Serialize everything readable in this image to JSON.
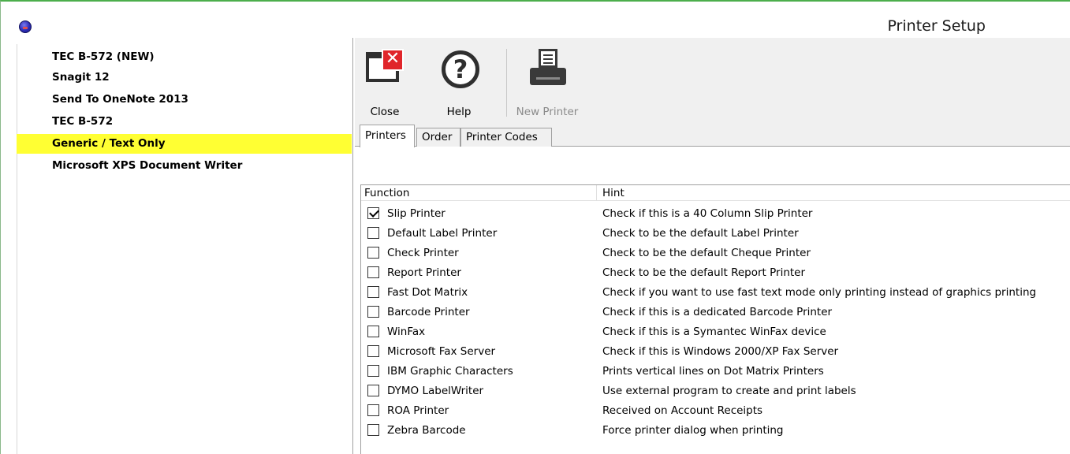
{
  "window": {
    "title": "Printer Setup"
  },
  "printers": [
    {
      "name": "TEC B-572 (NEW)",
      "selected": false
    },
    {
      "name": "Snagit 12",
      "selected": false
    },
    {
      "name": "Send To OneNote 2013",
      "selected": false
    },
    {
      "name": "TEC B-572",
      "selected": false
    },
    {
      "name": "Generic / Text Only",
      "selected": true
    },
    {
      "name": "Microsoft XPS Document Writer",
      "selected": false
    }
  ],
  "toolbar": {
    "close_label": "Close",
    "help_label": "Help",
    "new_printer_label": "New Printer",
    "new_printer_enabled": false
  },
  "tabs": [
    {
      "label": "Printers",
      "active": true
    },
    {
      "label": "Order",
      "active": false
    },
    {
      "label": "Printer Codes",
      "active": false
    }
  ],
  "grid": {
    "columns": [
      "Function",
      "Hint"
    ],
    "rows": [
      {
        "function": "Slip Printer",
        "hint": "Check if this is a 40 Column Slip Printer",
        "checked": true
      },
      {
        "function": "Default Label Printer",
        "hint": "Check to be the default Label Printer",
        "checked": false
      },
      {
        "function": "Check Printer",
        "hint": "Check to be the default Cheque Printer",
        "checked": false
      },
      {
        "function": "Report Printer",
        "hint": "Check to be the default Report Printer",
        "checked": false
      },
      {
        "function": "Fast Dot Matrix",
        "hint": "Check if you want to use fast text mode only printing instead of graphics printing",
        "checked": false
      },
      {
        "function": "Barcode Printer",
        "hint": "Check if this is a dedicated Barcode Printer",
        "checked": false
      },
      {
        "function": "WinFax",
        "hint": "Check if this is a Symantec WinFax device",
        "checked": false
      },
      {
        "function": "Microsoft Fax Server",
        "hint": "Check if this is Windows 2000/XP Fax Server",
        "checked": false
      },
      {
        "function": "IBM Graphic Characters",
        "hint": "Prints vertical lines on Dot Matrix Printers",
        "checked": false
      },
      {
        "function": "DYMO LabelWriter",
        "hint": "Use external program to create and print labels",
        "checked": false
      },
      {
        "function": "ROA Printer",
        "hint": "Received on Account Receipts",
        "checked": false
      },
      {
        "function": "Zebra Barcode",
        "hint": "Force printer dialog when printing",
        "checked": false
      }
    ]
  },
  "colors": {
    "selection": "#ffff33",
    "title_border": "#4cae4c",
    "close_icon_red": "#e0252a"
  }
}
